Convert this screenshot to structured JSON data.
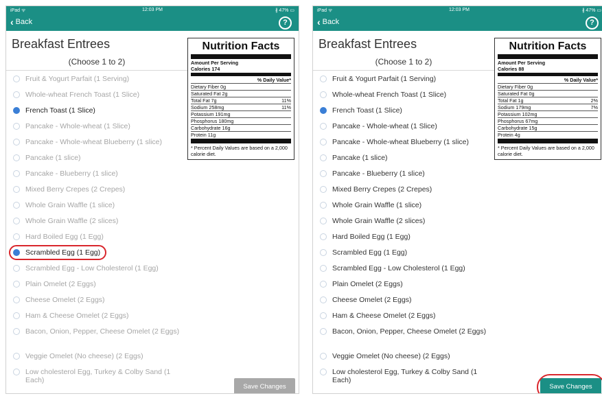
{
  "status": {
    "carrier": "iPad ᯤ",
    "time": "12:03 PM",
    "battery": "∦ 47% ▭"
  },
  "nav": {
    "back_label": "Back",
    "help_label": "?"
  },
  "page": {
    "title": "Breakfast Entrees",
    "subtitle": "(Choose 1 to 2)",
    "save_label": "Save Changes"
  },
  "colors": {
    "accent": "#1b8f85",
    "selected_radio": "#3b7fd6",
    "annotation": "#d9262c",
    "disabled_button": "#a8a8a8"
  },
  "items": [
    "Fruit & Yogurt Parfait (1 Serving)",
    "Whole-wheat French Toast (1 Slice)",
    "French Toast (1 Slice)",
    "Pancake - Whole-wheat (1 Slice)",
    "Pancake - Whole-wheat Blueberry (1 slice)",
    "Pancake (1 slice)",
    "Pancake - Blueberry (1 slice)",
    "Mixed Berry Crepes (2 Crepes)",
    "Whole Grain Waffle (1 slice)",
    "Whole Grain Waffle (2 slices)",
    "Hard Boiled Egg (1 Egg)",
    "Scrambled Egg (1 Egg)",
    "Scrambled Egg - Low Cholesterol (1 Egg)",
    "Plain Omelet (2 Eggs)",
    "Cheese Omelet (2 Eggs)",
    "Ham & Cheese Omelet (2 Eggs)",
    "Bacon, Onion, Pepper, Cheese Omelet (2 Eggs)",
    "Veggie Omelet (No cheese) (2 Eggs)",
    "Low cholesterol Egg, Turkey & Colby Sand (1 Each)"
  ],
  "screen1": {
    "selected": [
      2,
      11
    ],
    "save_enabled": false,
    "nutrition": {
      "title": "Nutrition Facts",
      "amount_per_serving": "Amount Per Serving",
      "calories": "Calories 174",
      "daily_value_header": "% Daily Value*",
      "fiber": "Dietary Fiber  0g",
      "sat_fat": "Saturated Fat  2g",
      "total_fat": "Total Fat  7g",
      "total_fat_pct": "11%",
      "sodium": "Sodium  258mg",
      "sodium_pct": "11%",
      "potassium": "Potassium  191mg",
      "phosphorus": "Phosphorus  180mg",
      "carbohydrate": "Carbohydrate  16g",
      "protein": "Protein  11g",
      "footnote": "* Percent Daily Values are based on a 2,000 calorie diet."
    }
  },
  "screen2": {
    "selected": [
      2
    ],
    "save_enabled": true,
    "nutrition": {
      "title": "Nutrition Facts",
      "amount_per_serving": "Amount Per Serving",
      "calories": "Calories 88",
      "daily_value_header": "% Daily Value*",
      "fiber": "Dietary Fiber  0g",
      "sat_fat": "Saturated Fat  0g",
      "total_fat": "Total Fat  1g",
      "total_fat_pct": "2%",
      "sodium": "Sodium  179mg",
      "sodium_pct": "7%",
      "potassium": "Potassium  102mg",
      "phosphorus": "Phosphorus  67mg",
      "carbohydrate": "Carbohydrate  15g",
      "protein": "Protein  4g",
      "footnote": "* Percent Daily Values are based on a 2,000 calorie diet."
    }
  }
}
